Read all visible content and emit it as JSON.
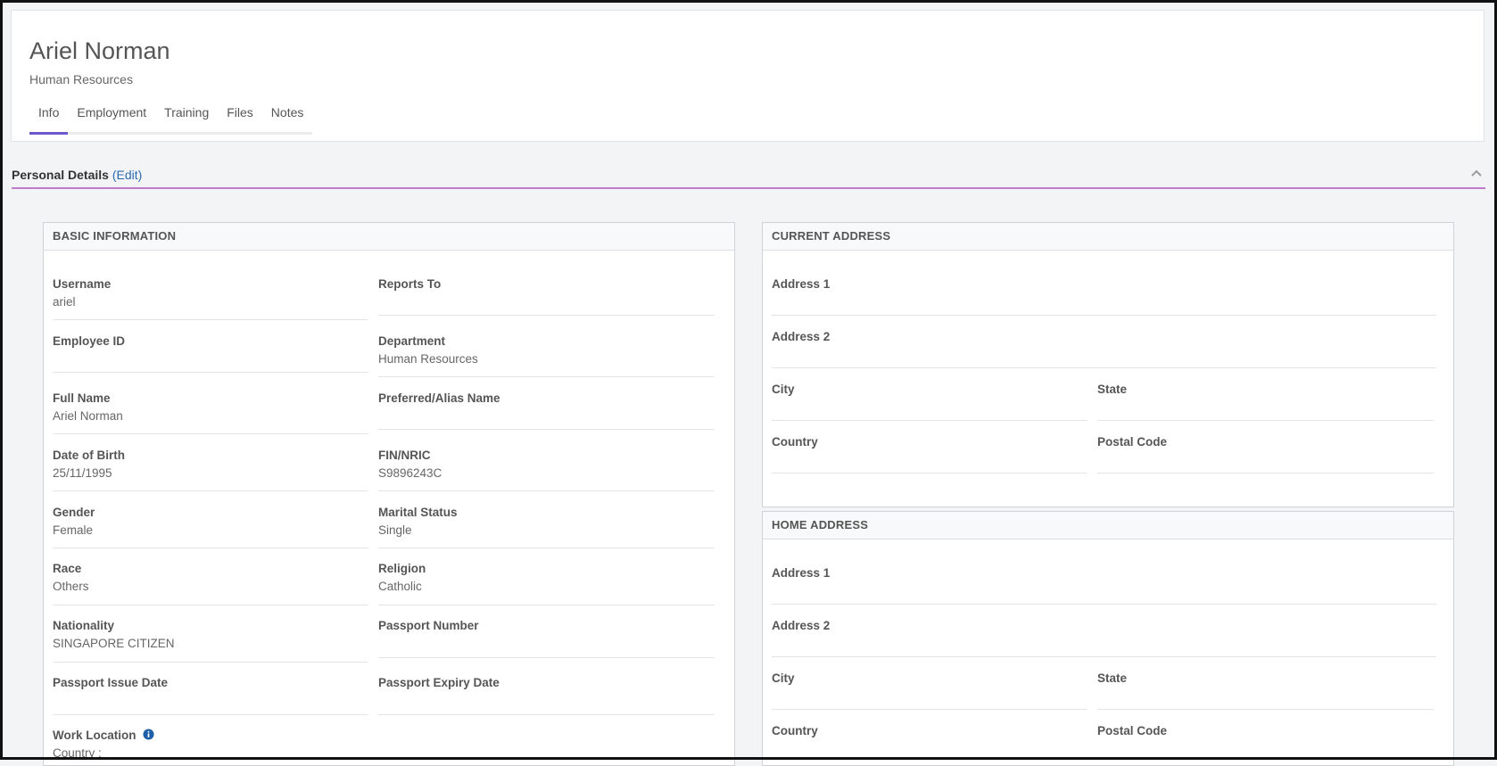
{
  "employee": {
    "name": "Ariel Norman",
    "department": "Human Resources"
  },
  "tabs": [
    {
      "label": "Info",
      "active": true
    },
    {
      "label": "Employment"
    },
    {
      "label": "Training"
    },
    {
      "label": "Files"
    },
    {
      "label": "Notes"
    }
  ],
  "section": {
    "title": "Personal Details",
    "edit_label": "(Edit)"
  },
  "basic": {
    "heading": "BASIC INFORMATION",
    "username": {
      "label": "Username",
      "value": "ariel"
    },
    "reports_to": {
      "label": "Reports To",
      "value": ""
    },
    "employee_id": {
      "label": "Employee ID",
      "value": ""
    },
    "department": {
      "label": "Department",
      "value": "Human Resources"
    },
    "full_name": {
      "label": "Full Name",
      "value": "Ariel Norman"
    },
    "alias": {
      "label": "Preferred/Alias Name",
      "value": ""
    },
    "dob": {
      "label": "Date of Birth",
      "value": "25/11/1995"
    },
    "fin": {
      "label": "FIN/NRIC",
      "value": "S9896243C"
    },
    "gender": {
      "label": "Gender",
      "value": "Female"
    },
    "marital": {
      "label": "Marital Status",
      "value": "Single"
    },
    "race": {
      "label": "Race",
      "value": "Others"
    },
    "religion": {
      "label": "Religion",
      "value": "Catholic"
    },
    "nationality": {
      "label": "Nationality",
      "value": "SINGAPORE CITIZEN"
    },
    "passport_no": {
      "label": "Passport Number",
      "value": ""
    },
    "passport_issue": {
      "label": "Passport Issue Date",
      "value": ""
    },
    "passport_expiry": {
      "label": "Passport Expiry Date",
      "value": ""
    },
    "work_location": {
      "label": "Work Location",
      "value": "Country :"
    }
  },
  "current_address": {
    "heading": "CURRENT ADDRESS",
    "address1": {
      "label": "Address 1",
      "value": ""
    },
    "address2": {
      "label": "Address 2",
      "value": ""
    },
    "city": {
      "label": "City",
      "value": ""
    },
    "state": {
      "label": "State",
      "value": ""
    },
    "country": {
      "label": "Country",
      "value": ""
    },
    "postal": {
      "label": "Postal Code",
      "value": ""
    }
  },
  "home_address": {
    "heading": "HOME ADDRESS",
    "address1": {
      "label": "Address 1",
      "value": ""
    },
    "address2": {
      "label": "Address 2",
      "value": ""
    },
    "city": {
      "label": "City",
      "value": ""
    },
    "state": {
      "label": "State",
      "value": ""
    },
    "country": {
      "label": "Country",
      "value": ""
    },
    "postal": {
      "label": "Postal Code",
      "value": ""
    }
  },
  "icons": {
    "collapse": "chevron-up-icon",
    "info": "info-circle-icon"
  },
  "colors": {
    "accent": "#6a5acd",
    "section_rule": "#c07ac8",
    "link": "#2b6cb0",
    "info_icon": "#1f5fa8"
  }
}
